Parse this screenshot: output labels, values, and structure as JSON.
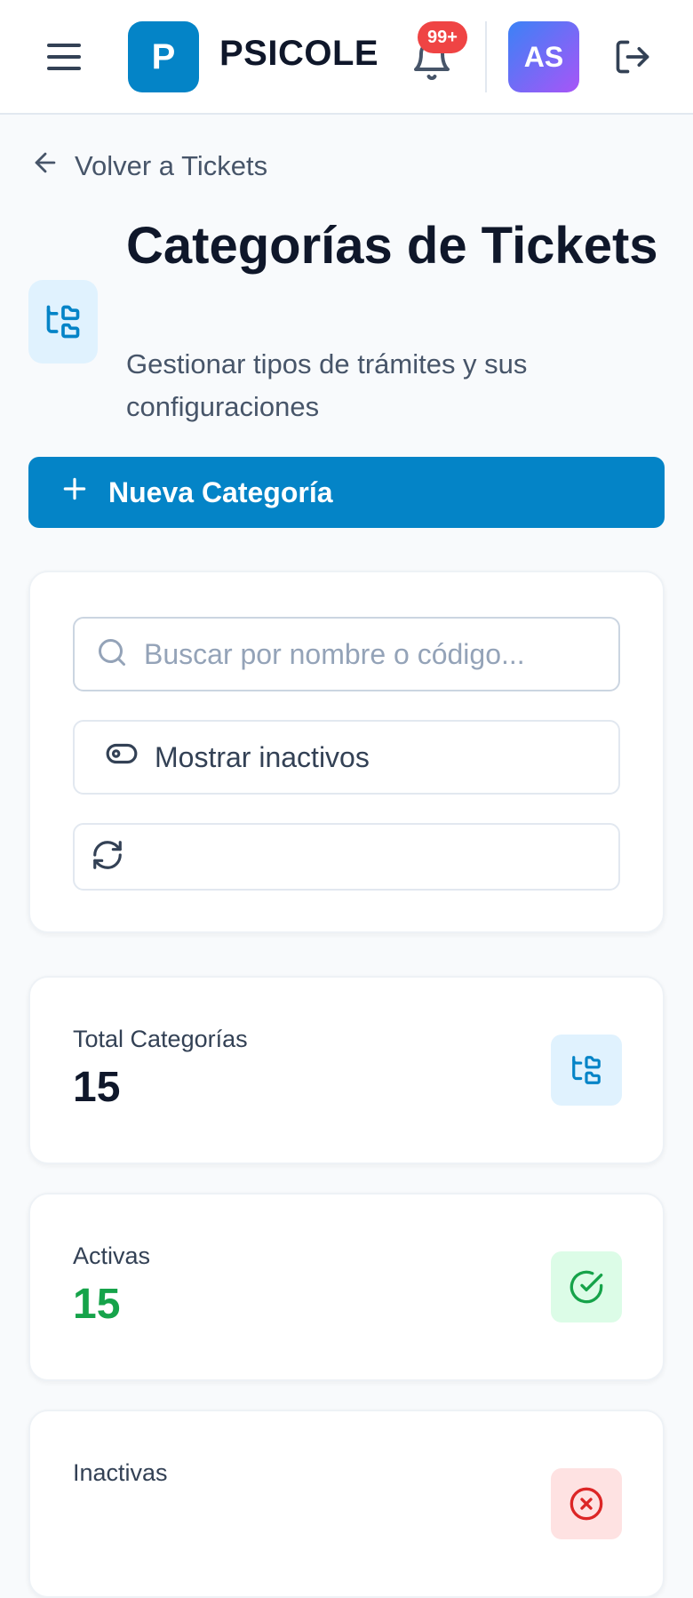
{
  "header": {
    "logo_letter": "P",
    "brand": "PSICOLE",
    "notifications_badge": "99+",
    "user_initials": "AS"
  },
  "nav": {
    "back_label": "Volver a Tickets"
  },
  "page": {
    "title": "Categorías de Tickets",
    "subtitle": "Gestionar tipos de trámites y sus configuraciones",
    "new_button_label": "Nueva Categoría"
  },
  "filters": {
    "search_placeholder": "Buscar por nombre o código...",
    "search_value": "",
    "show_inactive_label": "Mostrar inactivos"
  },
  "stats": [
    {
      "label": "Total Categorías",
      "value": "15",
      "accent": "#0f172a",
      "icon": "folder-tree-icon"
    },
    {
      "label": "Activas",
      "value": "15",
      "accent": "#16a34a",
      "icon": "check-circle-icon"
    },
    {
      "label": "Inactivas",
      "value": "",
      "accent": "#dc2626",
      "icon": "x-circle-icon"
    }
  ],
  "colors": {
    "primary": "#0484c7",
    "badge": "#ef4444",
    "success": "#16a34a",
    "danger": "#dc2626"
  }
}
